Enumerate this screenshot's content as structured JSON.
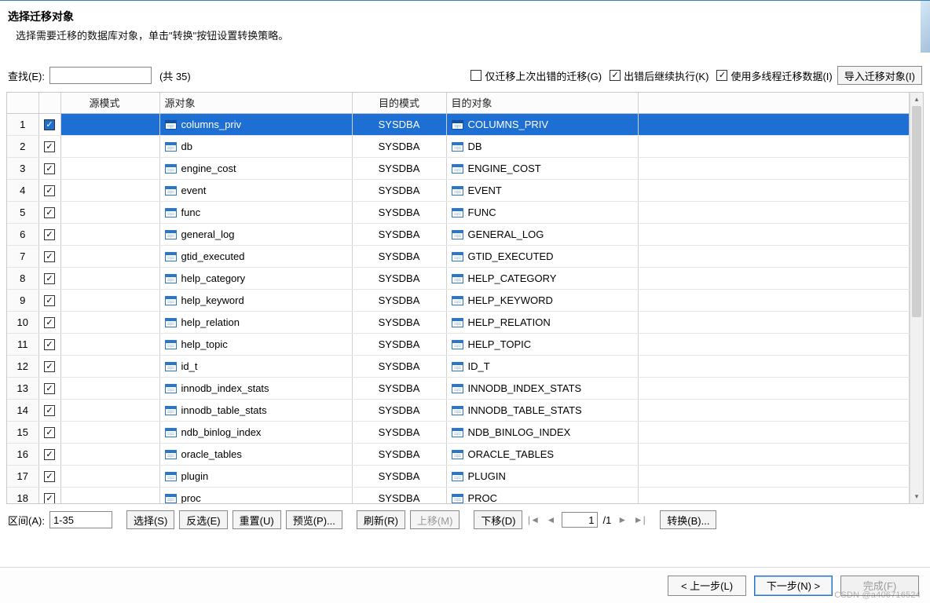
{
  "header": {
    "title": "选择迁移对象",
    "subtitle": "选择需要迁移的数据库对象，单击\"转换\"按钮设置转换策略。"
  },
  "find": {
    "label": "查找(E):",
    "value": "",
    "count_text": "(共 35)"
  },
  "options": {
    "only_error": {
      "label": "仅迁移上次出错的迁移(G)",
      "checked": false
    },
    "continue_on_error": {
      "label": "出错后继续执行(K)",
      "checked": true
    },
    "multithread": {
      "label": "使用多线程迁移数据(I)",
      "checked": true
    },
    "import_button": "导入迁移对象(I)"
  },
  "columns": {
    "source_schema": "源模式",
    "source_object": "源对象",
    "dest_schema": "目的模式",
    "dest_object": "目的对象"
  },
  "rows": [
    {
      "n": 1,
      "checked": true,
      "srcSchema": "",
      "srcObj": "columns_priv",
      "dstSchema": "SYSDBA",
      "dstObj": "COLUMNS_PRIV",
      "selected": true
    },
    {
      "n": 2,
      "checked": true,
      "srcSchema": "",
      "srcObj": "db",
      "dstSchema": "SYSDBA",
      "dstObj": "DB"
    },
    {
      "n": 3,
      "checked": true,
      "srcSchema": "",
      "srcObj": "engine_cost",
      "dstSchema": "SYSDBA",
      "dstObj": "ENGINE_COST"
    },
    {
      "n": 4,
      "checked": true,
      "srcSchema": "",
      "srcObj": "event",
      "dstSchema": "SYSDBA",
      "dstObj": "EVENT"
    },
    {
      "n": 5,
      "checked": true,
      "srcSchema": "",
      "srcObj": "func",
      "dstSchema": "SYSDBA",
      "dstObj": "FUNC"
    },
    {
      "n": 6,
      "checked": true,
      "srcSchema": "",
      "srcObj": "general_log",
      "dstSchema": "SYSDBA",
      "dstObj": "GENERAL_LOG"
    },
    {
      "n": 7,
      "checked": true,
      "srcSchema": "",
      "srcObj": "gtid_executed",
      "dstSchema": "SYSDBA",
      "dstObj": "GTID_EXECUTED"
    },
    {
      "n": 8,
      "checked": true,
      "srcSchema": "",
      "srcObj": "help_category",
      "dstSchema": "SYSDBA",
      "dstObj": "HELP_CATEGORY"
    },
    {
      "n": 9,
      "checked": true,
      "srcSchema": "",
      "srcObj": "help_keyword",
      "dstSchema": "SYSDBA",
      "dstObj": "HELP_KEYWORD"
    },
    {
      "n": 10,
      "checked": true,
      "srcSchema": "",
      "srcObj": "help_relation",
      "dstSchema": "SYSDBA",
      "dstObj": "HELP_RELATION"
    },
    {
      "n": 11,
      "checked": true,
      "srcSchema": "",
      "srcObj": "help_topic",
      "dstSchema": "SYSDBA",
      "dstObj": "HELP_TOPIC"
    },
    {
      "n": 12,
      "checked": true,
      "srcSchema": "",
      "srcObj": "id_t",
      "dstSchema": "SYSDBA",
      "dstObj": "ID_T"
    },
    {
      "n": 13,
      "checked": true,
      "srcSchema": "",
      "srcObj": "innodb_index_stats",
      "dstSchema": "SYSDBA",
      "dstObj": "INNODB_INDEX_STATS"
    },
    {
      "n": 14,
      "checked": true,
      "srcSchema": "",
      "srcObj": "innodb_table_stats",
      "dstSchema": "SYSDBA",
      "dstObj": "INNODB_TABLE_STATS"
    },
    {
      "n": 15,
      "checked": true,
      "srcSchema": "",
      "srcObj": "ndb_binlog_index",
      "dstSchema": "SYSDBA",
      "dstObj": "NDB_BINLOG_INDEX"
    },
    {
      "n": 16,
      "checked": true,
      "srcSchema": "",
      "srcObj": "oracle_tables",
      "dstSchema": "SYSDBA",
      "dstObj": "ORACLE_TABLES"
    },
    {
      "n": 17,
      "checked": true,
      "srcSchema": "",
      "srcObj": "plugin",
      "dstSchema": "SYSDBA",
      "dstObj": "PLUGIN"
    },
    {
      "n": 18,
      "checked": true,
      "srcSchema": "",
      "srcObj": "proc",
      "dstSchema": "SYSDBA",
      "dstObj": "PROC"
    }
  ],
  "controls": {
    "range_label": "区间(A):",
    "range_value": "1-35",
    "select": "选择(S)",
    "invert": "反选(E)",
    "reset": "重置(U)",
    "preview": "预览(P)...",
    "refresh": "刷新(R)",
    "move_up": "上移(M)",
    "move_down": "下移(D)",
    "page_current": "1",
    "page_total": "/1",
    "convert": "转换(B)..."
  },
  "wizard": {
    "back": "< 上一步(L)",
    "next": "下一步(N) >",
    "finish": "完成(F)"
  },
  "watermark": "CSDN @a406716524"
}
